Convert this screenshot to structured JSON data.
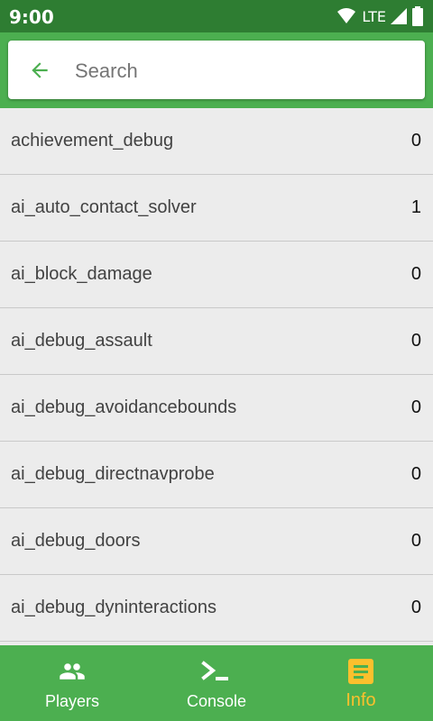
{
  "status_bar": {
    "time": "9:00",
    "network": "LTE",
    "icons": [
      "wifi-icon",
      "cell-signal-icon",
      "battery-icon"
    ]
  },
  "search": {
    "placeholder": "Search",
    "value": "",
    "back_icon": "arrow-back-icon"
  },
  "variables": [
    {
      "name": "achievement_debug",
      "value": "0"
    },
    {
      "name": "ai_auto_contact_solver",
      "value": "1"
    },
    {
      "name": "ai_block_damage",
      "value": "0"
    },
    {
      "name": "ai_debug_assault",
      "value": "0"
    },
    {
      "name": "ai_debug_avoidancebounds",
      "value": "0"
    },
    {
      "name": "ai_debug_directnavprobe",
      "value": "0"
    },
    {
      "name": "ai_debug_doors",
      "value": "0"
    },
    {
      "name": "ai_debug_dyninteractions",
      "value": "0"
    }
  ],
  "bottom_nav": {
    "items": [
      {
        "label": "Players",
        "icon": "people-icon",
        "active": false
      },
      {
        "label": "Console",
        "icon": "terminal-icon",
        "active": false
      },
      {
        "label": "Info",
        "icon": "notes-icon",
        "active": true
      }
    ]
  },
  "colors": {
    "status_bar": "#2e7d32",
    "primary": "#4caf50",
    "active_nav": "#fbc02d",
    "list_background": "#ececec"
  }
}
